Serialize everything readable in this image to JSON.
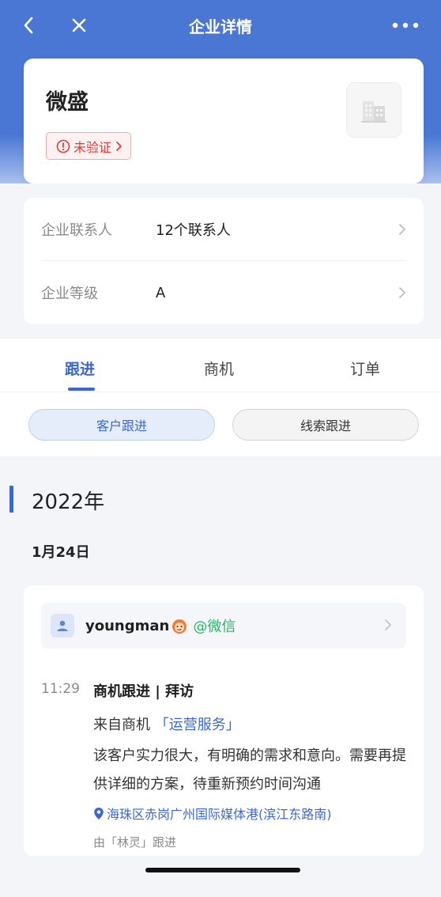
{
  "navbar": {
    "title": "企业详情",
    "back_icon": "chevron-left-icon",
    "close_icon": "close-icon",
    "more_icon": "more-dots-icon"
  },
  "company": {
    "name": "微盛",
    "verify_label": "未验证",
    "logo_icon": "building-icon"
  },
  "info": {
    "rows": [
      {
        "label": "企业联系人",
        "value": "12个联系人"
      },
      {
        "label": "企业等级",
        "value": "A"
      }
    ]
  },
  "tabs": [
    {
      "label": "跟进",
      "active": true
    },
    {
      "label": "商机",
      "active": false
    },
    {
      "label": "订单",
      "active": false
    }
  ],
  "segments": [
    {
      "label": "客户跟进",
      "active": true
    },
    {
      "label": "线索跟进",
      "active": false
    }
  ],
  "timeline": {
    "year": "2022年",
    "date": "1月24日",
    "record": {
      "user_name": "youngman",
      "user_source": "@微信",
      "time": "11:29",
      "title": "商机跟进 | 拜访",
      "from_prefix": "来自商机",
      "from_link": "「运营服务」",
      "content": "该客户实力很大，有明确的需求和意向。需要再提供详细的方案，待重新预约时间沟通",
      "location": "海珠区赤岗广州国际媒体港(滨江东路南)",
      "followed_by": "由「林灵」跟进"
    }
  },
  "colors": {
    "brand_blue": "#4a77d4",
    "accent_blue": "#3a68d0",
    "warning_red": "#e23a3a",
    "wechat_green": "#2db36b"
  }
}
